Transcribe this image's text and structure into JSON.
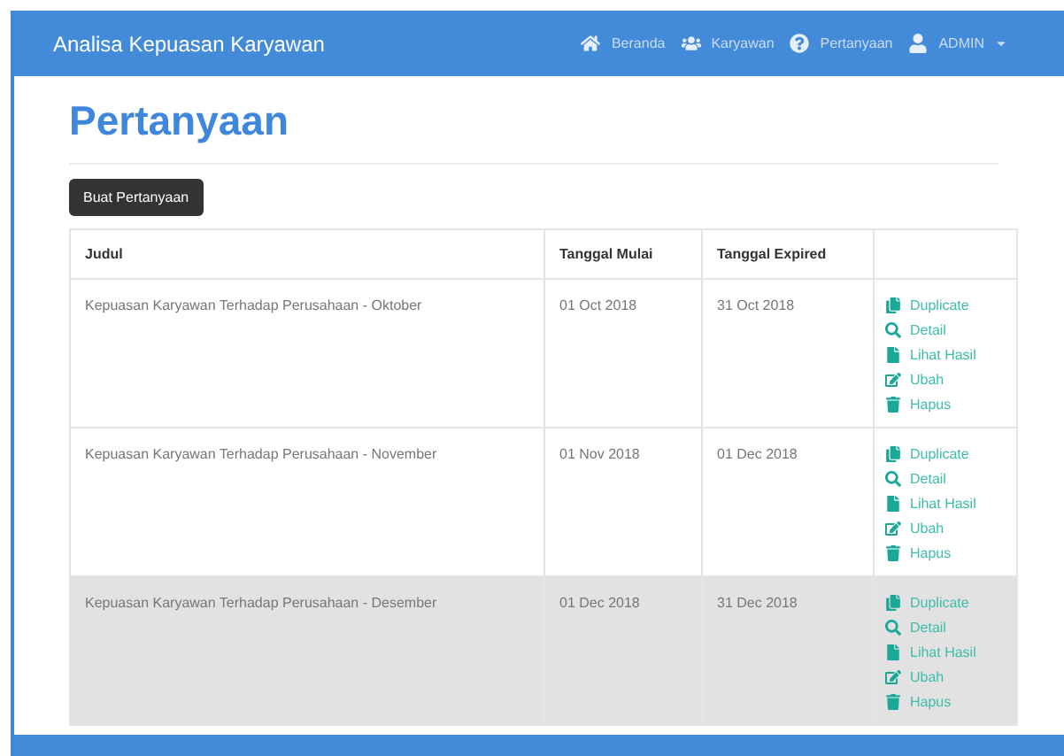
{
  "navbar": {
    "brand": "Analisa Kepuasan Karyawan",
    "links": [
      {
        "kind": "home",
        "label": "Beranda"
      },
      {
        "kind": "users",
        "label": "Karyawan"
      },
      {
        "kind": "question",
        "label": "Pertanyaan"
      },
      {
        "kind": "user",
        "label": "ADMIN",
        "dropdown": true
      }
    ]
  },
  "page": {
    "title": "Pertanyaan",
    "create_button": "Buat Pertanyaan"
  },
  "table": {
    "columns": [
      "Judul",
      "Tanggal Mulai",
      "Tanggal Expired"
    ],
    "rows": [
      {
        "judul": "Kepuasan Karyawan Terhadap Perusahaan - Oktober",
        "mulai": "01 Oct 2018",
        "expired": "31 Oct 2018",
        "hovered": false,
        "actions": [
          {
            "kind": "duplicate",
            "label": "Duplicate"
          },
          {
            "kind": "detail",
            "label": "Detail"
          },
          {
            "kind": "result",
            "label": "Lihat Hasil"
          },
          {
            "kind": "edit",
            "label": "Ubah"
          },
          {
            "kind": "delete",
            "label": "Hapus"
          }
        ]
      },
      {
        "judul": "Kepuasan Karyawan Terhadap Perusahaan - November",
        "mulai": "01 Nov 2018",
        "expired": "01 Dec 2018",
        "hovered": false,
        "actions": [
          {
            "kind": "duplicate",
            "label": "Duplicate"
          },
          {
            "kind": "detail",
            "label": "Detail"
          },
          {
            "kind": "result",
            "label": "Lihat Hasil"
          },
          {
            "kind": "edit",
            "label": "Ubah"
          },
          {
            "kind": "delete",
            "label": "Hapus"
          }
        ]
      },
      {
        "judul": "Kepuasan Karyawan Terhadap Perusahaan - Desember",
        "mulai": "01 Dec 2018",
        "expired": "31 Dec 2018",
        "hovered": true,
        "actions": [
          {
            "kind": "duplicate",
            "label": "Duplicate"
          },
          {
            "kind": "detail",
            "label": "Detail"
          },
          {
            "kind": "result",
            "label": "Lihat Hasil"
          },
          {
            "kind": "edit",
            "label": "Ubah"
          },
          {
            "kind": "delete",
            "label": "Hapus"
          }
        ]
      }
    ]
  }
}
